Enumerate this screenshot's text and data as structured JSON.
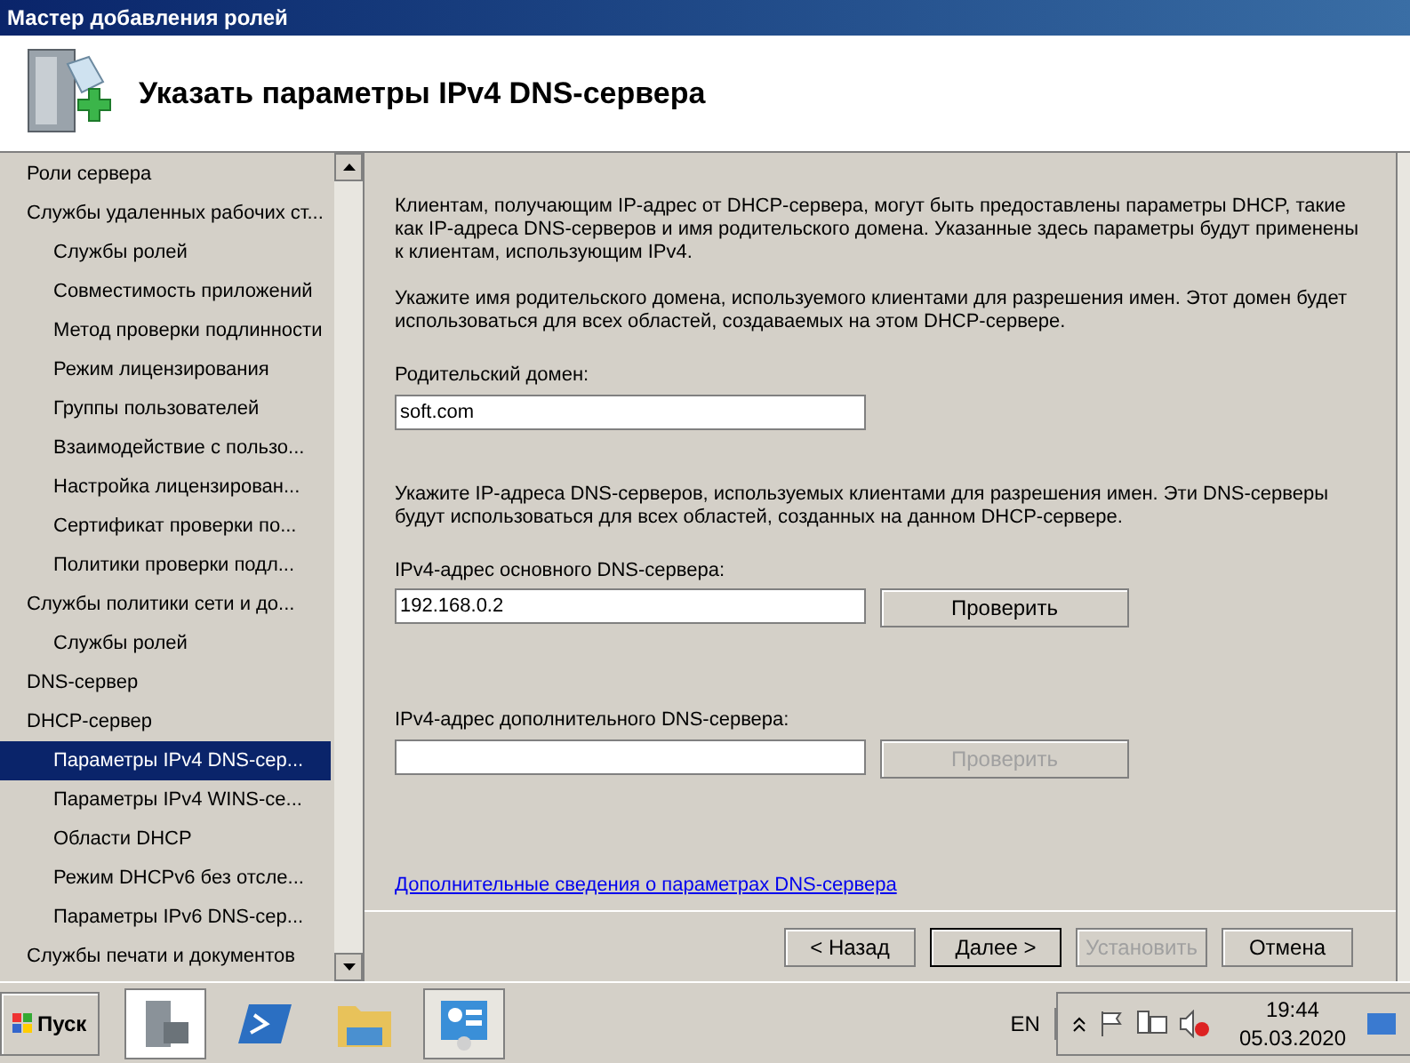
{
  "window": {
    "title": "Мастер добавления ролей"
  },
  "header": {
    "title": "Указать параметры IPv4 DNS-сервера"
  },
  "sidebar": {
    "items": [
      {
        "label": "Роли сервера",
        "selected": false
      },
      {
        "label": "Службы удаленных рабочих ст...",
        "selected": false,
        "children": [
          {
            "label": "Службы ролей",
            "selected": false
          },
          {
            "label": "Совместимость приложений",
            "selected": false
          },
          {
            "label": "Метод проверки подлинности",
            "selected": false
          },
          {
            "label": "Режим лицензирования",
            "selected": false
          },
          {
            "label": "Группы пользователей",
            "selected": false
          },
          {
            "label": "Взаимодействие с пользо...",
            "selected": false
          },
          {
            "label": "Настройка лицензирован...",
            "selected": false
          },
          {
            "label": "Сертификат проверки по...",
            "selected": false
          },
          {
            "label": "Политики проверки подл...",
            "selected": false
          }
        ]
      },
      {
        "label": "Службы политики сети и до...",
        "selected": false,
        "children": [
          {
            "label": "Службы ролей",
            "selected": false
          }
        ]
      },
      {
        "label": "DNS-сервер",
        "selected": false
      },
      {
        "label": "DHCP-сервер",
        "selected": false,
        "children": [
          {
            "label": "Параметры IPv4 DNS-сер...",
            "selected": true
          },
          {
            "label": "Параметры IPv4 WINS-се...",
            "selected": false
          },
          {
            "label": "Области DHCP",
            "selected": false
          },
          {
            "label": "Режим DHCPv6 без отсле...",
            "selected": false
          },
          {
            "label": "Параметры IPv6 DNS-сер...",
            "selected": false
          }
        ]
      },
      {
        "label": "Службы печати и документов",
        "selected": false
      }
    ]
  },
  "content": {
    "intro": "Клиентам, получающим IP-адрес от DHCP-сервера, могут быть предоставлены параметры DHCP, такие как IP-адреса DNS-серверов и имя родительского домена. Указанные здесь параметры будут применены к клиентам, использующим IPv4.",
    "domain_hint": "Укажите имя родительского домена, используемого клиентами для разрешения имен. Этот домен будет использоваться для всех областей, создаваемых на этом DHCP-сервере.",
    "domain": {
      "label": "Родительский домен:",
      "value": "soft.com"
    },
    "dns_hint": "Укажите IP-адреса DNS-серверов, используемых клиентами для разрешения имен. Эти DNS-серверы будут использоваться для всех областей, созданных на данном DHCP-сервере.",
    "dns_fields": [
      {
        "label": "IPv4-адрес основного DNS-сервера:",
        "value": "192.168.0.2",
        "button": "Проверить",
        "disabled": false
      },
      {
        "label": "IPv4-адрес дополнительного DNS-сервера:",
        "button": "Проверить",
        "disabled": true
      }
    ],
    "link": "Дополнительные сведения о параметрах DNS-сервера"
  },
  "buttons": [
    {
      "label": "< Назад",
      "disabled": false,
      "selected": false
    },
    {
      "label": "Далее >",
      "disabled": false,
      "selected": true
    },
    {
      "label": "Установить",
      "disabled": true,
      "selected": false
    },
    {
      "label": "Отмена",
      "disabled": false,
      "selected": false
    }
  ],
  "taskbar": {
    "start": "Пуск",
    "language": "EN",
    "time": "19:44",
    "date": "05.03.2020"
  }
}
